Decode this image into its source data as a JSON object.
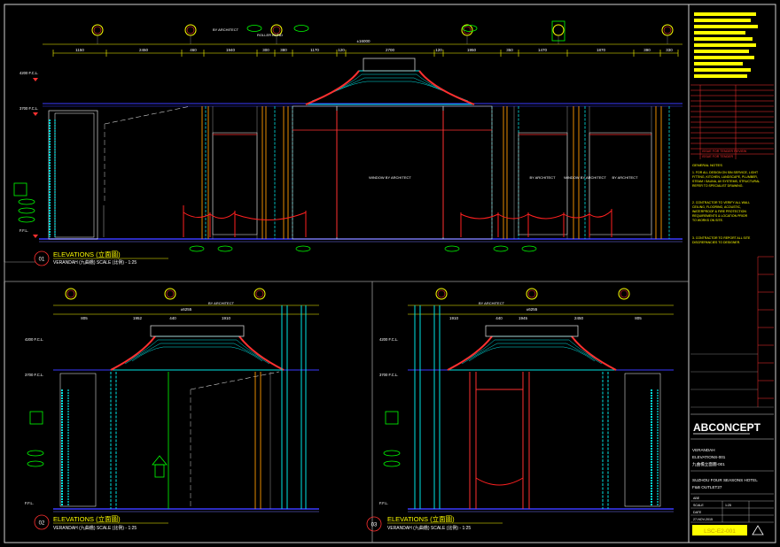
{
  "title_block": {
    "logo": "ABCONCEPT",
    "project_lines": [
      "VERANDAH",
      "ELEVATIONS-001",
      "九曲檐立面圖-001"
    ],
    "client_lines": [
      "SUZHOU FOUR SEASONS HOTEL",
      "F&B OUTLET27"
    ],
    "drawing_no": "LSC-E2-001",
    "issue_notes": [
      "ISSUE FOR TENDER REVIEW",
      "ISSUE FOR TENDER"
    ],
    "general_notes_title": "GENERAL NOTES",
    "general_notes": [
      "1. FOR ALL DESIGN ON SIN SERVICE, LIGHT",
      "FITTING, KITCHEN, LANDSCAPE, PLUMBER,",
      "STEAM / SAUNA, AV SYSTEMS, STRUCTURAL",
      "REFER TO SPECIALIST DRAWING.",
      "2. CONTRACTOR TO VERIFY ALL WALL",
      "CEILING, FLOORING, ACOUSTIC,",
      "WATERPROOF & FIRE PROTECTION",
      "REQUIREMENTS & LOCATION PRIOR",
      "TO WORKS ON SITE.",
      "3. CONTRACTOR TO REPORT ALL SITE",
      "DISCREPANCIES TO DESIGNER."
    ],
    "date_cells": [
      "ABE",
      "SCALE",
      "1:25",
      "DATE",
      "27-NOV-2015"
    ]
  },
  "views": [
    {
      "num": "01",
      "title": "ELEVATIONS (立面圖)",
      "subtitle": "VERANDAH (九曲檐)   SCALE (比例) - 1:25"
    },
    {
      "num": "02",
      "title": "ELEVATIONS (立面圖)",
      "subtitle": "VERANDAH (九曲檐)   SCALE (比例) - 1:25"
    },
    {
      "num": "03",
      "title": "ELEVATIONS (立面圖)",
      "subtitle": "VERANDAH (九曲檐)   SCALE (比例) - 1:25"
    }
  ],
  "dims": {
    "top1": [
      "1150",
      "2450",
      "460",
      "1940",
      "300",
      "380",
      "1170",
      "120",
      "2700",
      "120",
      "1950",
      "350",
      "1470",
      "1870",
      "390",
      "330"
    ],
    "top1_overall": "±16000",
    "top2": [
      "805",
      "1952",
      "440",
      "1910"
    ],
    "top2_overall": "±6255",
    "top3": [
      "1910",
      "440",
      "1945",
      "2450",
      "805"
    ],
    "top3_overall": "±6255"
  },
  "levels": {
    "a": "4200 F.C.L.",
    "b": "3700 F.C.L.",
    "c": "F.F.L.",
    "d": "3370 F.C.L."
  },
  "annotations": {
    "by_architect": "BY ARCHITECT",
    "window_by_architect": "WINDOW BY ARCHITECT",
    "roller_blind": "ROLLER BLIND"
  },
  "colors": {
    "background": "#000000",
    "border": "#ffffff",
    "dimension": "#ffff00",
    "window_blue": "#3a3aff",
    "roof_cyan": "#00e5e5",
    "roof_red": "#ff3030",
    "tags": "#00ff00",
    "stanchion": "#ff2020",
    "column_orange": "#ff9a00"
  }
}
